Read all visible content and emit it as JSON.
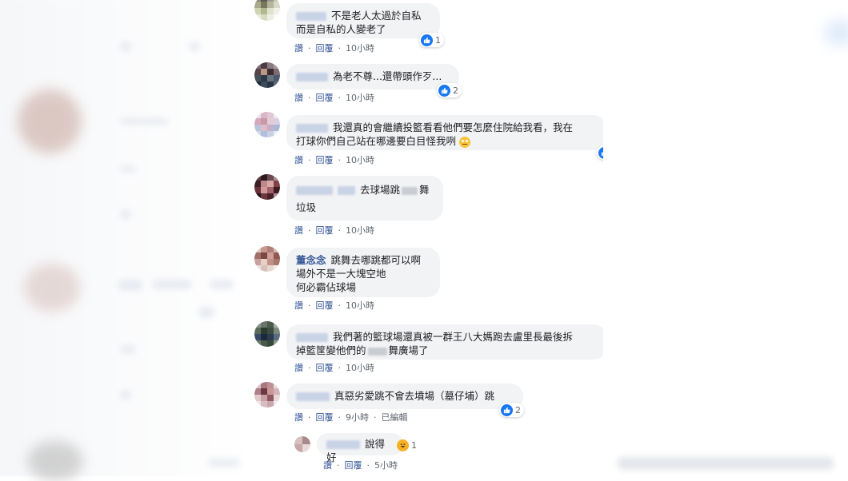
{
  "comments": [
    {
      "lines": [
        "不是老人太過於自私",
        "而是自私的人變老了"
      ],
      "reaction_count": "1",
      "like_label": "讚",
      "reply_label": "回覆",
      "time": "10小時"
    },
    {
      "lines": [
        "為老不尊...還帶頭作歹..."
      ],
      "reaction_count": "2",
      "like_label": "讚",
      "reply_label": "回覆",
      "time": "10小時"
    },
    {
      "lines": [
        "我還真的會繼續投籃看看他們要怎麼住院給我看，我在",
        "打球你們自己站在哪邊要白目怪我咧"
      ],
      "reaction_count": "",
      "like_label": "讚",
      "reply_label": "回覆",
      "time": "10小時"
    },
    {
      "line1_a": "去球場跳",
      "line1_b": "舞",
      "line2": "垃圾",
      "like_label": "讚",
      "reply_label": "回覆",
      "time": "10小時"
    },
    {
      "name": "董念念",
      "lines": [
        "跳舞去哪跳都可以啊",
        "場外不是一大塊空地",
        "何必霸佔球場"
      ],
      "like_label": "讚",
      "reply_label": "回覆",
      "time": "10小時"
    },
    {
      "line1": "我們著的籃球場還真被一群王八大媽跑去盧里長最後拆",
      "line2_a": "掉籃筐變他們的",
      "line2_b": "舞廣場了",
      "like_label": "讚",
      "reply_label": "回覆",
      "time": "10小時"
    },
    {
      "lines": [
        "真惡劣愛跳不會去墳場（墓仔埔）跳"
      ],
      "reaction_count": "2",
      "like_label": "讚",
      "reply_label": "回覆",
      "time": "9小時",
      "edited": "已編輯"
    }
  ],
  "reply": {
    "text": "說得好",
    "reaction_count": "1",
    "like_label": "讚",
    "reply_label": "回覆",
    "time": "5小時"
  },
  "separator": "·",
  "colors": {
    "like": "#1877f2",
    "haha": "#f7b125",
    "link": "#385898",
    "bubble": "#f2f3f5"
  }
}
